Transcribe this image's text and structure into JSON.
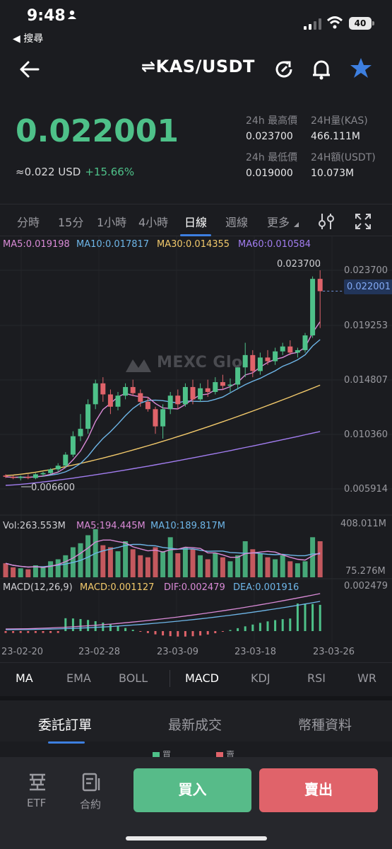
{
  "status_bar": {
    "time": "9:48",
    "back_app": "◀ 搜尋",
    "battery": "40"
  },
  "nav": {
    "pair": "KAS/USDT",
    "swap_glyph": "⇌"
  },
  "price": {
    "last": "0.022001",
    "usd": "≈0.022 USD",
    "change": "+15.66%",
    "stats": [
      {
        "label": "24h 最高價",
        "value": "0.023700"
      },
      {
        "label": "24H量(KAS)",
        "value": "466.111M"
      },
      {
        "label": "24h 最低價",
        "value": "0.019000"
      },
      {
        "label": "24H額(USDT)",
        "value": "10.073M"
      }
    ]
  },
  "timeframes": [
    "分時",
    "15分",
    "1小時",
    "4小時",
    "日線",
    "週線",
    "更多"
  ],
  "active_timeframe": "日線",
  "chart_labels": {
    "ma5": "MA5:0.019198",
    "ma10": "MA10:0.017817",
    "ma30": "MA30:0.014355",
    "ma60": "MA60:0.010584",
    "price_axis": [
      "0.023700",
      "0.019253",
      "0.014807",
      "0.010360",
      "0.005914"
    ],
    "current_price": "0.022001",
    "high_marker": "0.023700",
    "low_marker": "0.006600",
    "watermark": "MEXC Glo",
    "vol": "Vol:263.553M",
    "vol_ma5": "MA5:194.445M",
    "vol_ma10": "MA10:189.817M",
    "vol_axis_top": "408.011M",
    "vol_axis_bottom": "75.276M",
    "macd_params": "MACD(12,26,9)",
    "macd": "MACD:0.001127",
    "dif": "DIF:0.002479",
    "dea": "DEA:0.001916",
    "macd_axis_top": "0.002479",
    "dates": [
      "23-02-20",
      "23-02-28",
      "23-03-09",
      "23-03-18",
      "23-03-26"
    ]
  },
  "colors": {
    "up": "#4ec189",
    "down": "#e0636a",
    "ma5": "#d98ad6",
    "ma10": "#6eb6e8",
    "ma30": "#f2c96b",
    "ma60": "#a27df0",
    "accent": "#3d7fe0"
  },
  "indicators": [
    "MA",
    "EMA",
    "BOLL",
    "MACD",
    "KDJ",
    "RSI",
    "WR"
  ],
  "sections": [
    "委託訂單",
    "最新成交",
    "幣種資料"
  ],
  "peek": {
    "buy": "買",
    "sell": "賣"
  },
  "bottom": {
    "etf": "ETF",
    "contract": "合約",
    "buy": "買入",
    "sell": "賣出"
  },
  "chart_data": {
    "type": "candlestick",
    "x": [
      "23-02-20",
      "23-02-28",
      "23-03-09",
      "23-03-18",
      "23-03-26"
    ],
    "price_range": [
      0.005914,
      0.0237
    ],
    "last_price": 0.022001,
    "high": 0.0237,
    "low": 0.0066,
    "series": [
      {
        "name": "MA5",
        "last": 0.019198
      },
      {
        "name": "MA10",
        "last": 0.017817
      },
      {
        "name": "MA30",
        "last": 0.014355
      },
      {
        "name": "MA60",
        "last": 0.010584
      }
    ],
    "candles_ohlc": [
      [
        0.007,
        0.0071,
        0.0068,
        0.0069
      ],
      [
        0.0069,
        0.007,
        0.0067,
        0.0068
      ],
      [
        0.0068,
        0.007,
        0.0066,
        0.0069
      ],
      [
        0.0069,
        0.0071,
        0.0067,
        0.0068
      ],
      [
        0.0068,
        0.0072,
        0.0067,
        0.0071
      ],
      [
        0.0071,
        0.0073,
        0.0069,
        0.0072
      ],
      [
        0.0072,
        0.0076,
        0.0071,
        0.0075
      ],
      [
        0.0075,
        0.008,
        0.0073,
        0.0078
      ],
      [
        0.0078,
        0.0089,
        0.0076,
        0.0087
      ],
      [
        0.0087,
        0.0106,
        0.0085,
        0.0102
      ],
      [
        0.0102,
        0.012,
        0.0098,
        0.0108
      ],
      [
        0.0108,
        0.0132,
        0.0104,
        0.0128
      ],
      [
        0.0128,
        0.0148,
        0.0124,
        0.0145
      ],
      [
        0.0145,
        0.015,
        0.013,
        0.0136
      ],
      [
        0.0136,
        0.014,
        0.012,
        0.0126
      ],
      [
        0.0126,
        0.0138,
        0.0123,
        0.0135
      ],
      [
        0.0135,
        0.0145,
        0.0132,
        0.0142
      ],
      [
        0.0142,
        0.0148,
        0.0135,
        0.0137
      ],
      [
        0.0137,
        0.014,
        0.0126,
        0.013
      ],
      [
        0.013,
        0.0134,
        0.0122,
        0.0124
      ],
      [
        0.0124,
        0.0126,
        0.0104,
        0.011
      ],
      [
        0.011,
        0.0128,
        0.01,
        0.0124
      ],
      [
        0.0124,
        0.0138,
        0.012,
        0.0135
      ],
      [
        0.0135,
        0.014,
        0.0124,
        0.0128
      ],
      [
        0.0128,
        0.0145,
        0.0126,
        0.0142
      ],
      [
        0.0142,
        0.0148,
        0.0128,
        0.0132
      ],
      [
        0.0132,
        0.0145,
        0.013,
        0.0141
      ],
      [
        0.0141,
        0.0148,
        0.0134,
        0.0138
      ],
      [
        0.0138,
        0.015,
        0.0136,
        0.0146
      ],
      [
        0.0146,
        0.0152,
        0.014,
        0.0143
      ],
      [
        0.0143,
        0.0149,
        0.0138,
        0.0144
      ],
      [
        0.0144,
        0.016,
        0.014,
        0.0158
      ],
      [
        0.0158,
        0.0178,
        0.015,
        0.0168
      ],
      [
        0.0168,
        0.0172,
        0.015,
        0.0155
      ],
      [
        0.0155,
        0.017,
        0.0152,
        0.0166
      ],
      [
        0.0166,
        0.0172,
        0.016,
        0.0163
      ],
      [
        0.0163,
        0.0174,
        0.016,
        0.0171
      ],
      [
        0.0171,
        0.0178,
        0.0168,
        0.0175
      ],
      [
        0.0175,
        0.018,
        0.0168,
        0.017
      ],
      [
        0.017,
        0.0174,
        0.0166,
        0.0172
      ],
      [
        0.0172,
        0.0186,
        0.017,
        0.0184
      ],
      [
        0.0184,
        0.0232,
        0.0182,
        0.023
      ],
      [
        0.023,
        0.0237,
        0.019,
        0.022
      ]
    ]
  }
}
